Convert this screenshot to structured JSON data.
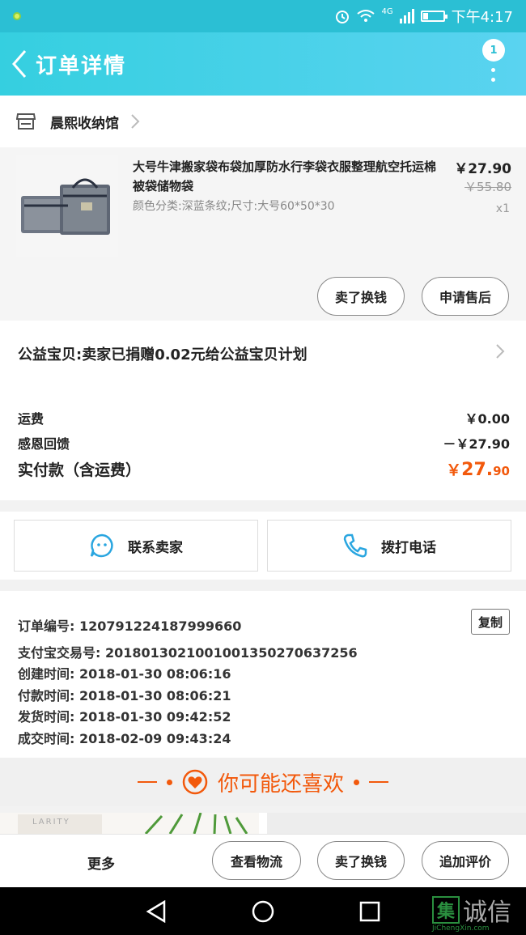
{
  "status_bar": {
    "time": "下午4:17",
    "network": "4G",
    "battery_level": 0.25
  },
  "header": {
    "title": "订单详情",
    "badge_count": "1"
  },
  "shop": {
    "name": "晨熙收纳馆"
  },
  "product": {
    "title": "大号牛津搬家袋布袋加厚防水行李袋衣服整理航空托运棉被袋储物袋",
    "spec": "颜色分类:深蓝条纹;尺寸:大号60*50*30",
    "price": "￥27.90",
    "original_price": "￥55.80",
    "quantity": "x1",
    "actions": [
      "卖了换钱",
      "申请售后"
    ]
  },
  "charity": {
    "text": "公益宝贝:卖家已捐赠0.02元给公益宝贝计划"
  },
  "fees": {
    "shipping_label": "运费",
    "shipping_value": "￥0.00",
    "discount_label": "感恩回馈",
    "discount_value": "－￥27.90",
    "total_label": "实付款（含运费）",
    "total_currency": "￥",
    "total_int": "27.",
    "total_dec": "90"
  },
  "contacts": {
    "seller": "联系卖家",
    "call": "拨打电话"
  },
  "order_info": {
    "order_no": "订单编号: 120791224187999660",
    "copy": "复制",
    "alipay_no": "支付宝交易号: 2018013021001001350270637256",
    "created": "创建时间: 2018-01-30 08:06:16",
    "paid": "付款时间: 2018-01-30 08:06:21",
    "shipped": "发货时间: 2018-01-30 09:42:52",
    "completed": "成交时间: 2018-02-09 09:43:24"
  },
  "recommend": {
    "title": "你可能还喜欢",
    "book_text": "LARITY"
  },
  "bottom_bar": {
    "more": "更多",
    "buttons": [
      "查看物流",
      "卖了换钱",
      "追加评价"
    ]
  },
  "watermark": {
    "brand": "诚信",
    "box": "集",
    "sub": "JiChengXin.com"
  },
  "colors": {
    "accent": "#2bbfd4",
    "orange": "#f2590c",
    "seller_icon": "#2aa6e0"
  }
}
